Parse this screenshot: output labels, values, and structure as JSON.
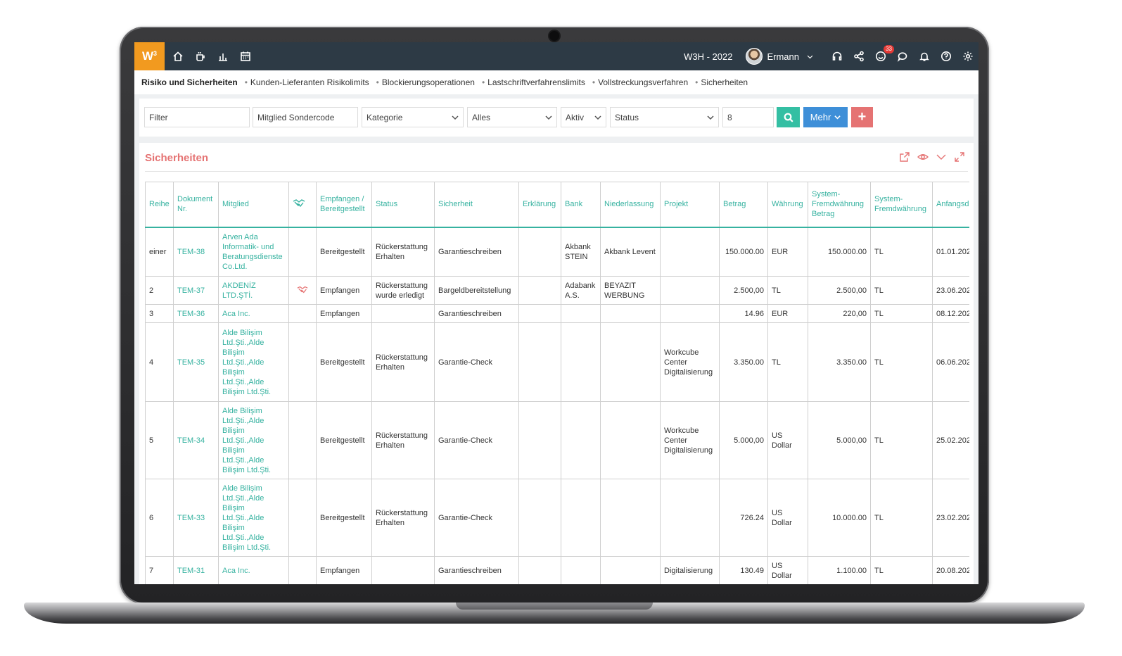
{
  "topbar": {
    "logo": "W",
    "logo_sup": "3",
    "period": "W3H - 2022",
    "user_name": "Ermann",
    "notification_count": "33",
    "nav_icons": [
      "home-icon",
      "coffee-icon",
      "bar-chart-icon",
      "calendar-icon"
    ],
    "right_icons": [
      "headset-icon",
      "share-icon",
      "smiley-icon",
      "chat-icon",
      "bell-icon",
      "help-icon",
      "gear-icon"
    ]
  },
  "breadcrumb": {
    "main": "Risiko und Sicherheiten",
    "items": [
      "Kunden-Lieferanten Risikolimits",
      "Blockierungsoperationen",
      "Lastschriftverfahrenslimits",
      "Vollstreckungsverfahren",
      "Sicherheiten"
    ]
  },
  "filters": {
    "filter": "Filter",
    "member_code": "Mitglied Sondercode",
    "category": "Kategorie",
    "all": "Alles",
    "active": "Aktiv",
    "status": "Status",
    "page_size": "8",
    "more_label": "Mehr",
    "add_label": "+"
  },
  "panel": {
    "title": "Sicherheiten"
  },
  "table": {
    "headers": [
      "Reihe",
      "Dokument Nr.",
      "Mitglied",
      "",
      "Empfangen / Bereitgestellt",
      "Status",
      "Sicherheit",
      "Erklärung",
      "Bank",
      "Niederlassung",
      "Projekt",
      "Betrag",
      "Währung",
      "System-Fremdwährung Betrag",
      "System-Fremdwährung",
      "Anfangsd"
    ],
    "rows": [
      {
        "reihe": "einer",
        "doc": "TEM-38",
        "member": "Arven Ada Informatik- und Beratungsdienste Co.Ltd.",
        "icon": "",
        "type": "Bereitgestellt",
        "status": "Rückerstattung Erhalten",
        "security": "Garantieschreiben",
        "note": "",
        "bank": "Akbank STEIN",
        "branch": "Akbank Levent",
        "project": "",
        "amount": "150.000.00",
        "currency": "EUR",
        "sys_amount": "150.000.00",
        "sys_currency": "TL",
        "start": "01.01.202"
      },
      {
        "reihe": "2",
        "doc": "TEM-37",
        "member": "AKDENİZ LTD.ŞTİ.",
        "icon": "handshake",
        "type": "Empfangen",
        "status": "Rückerstattung wurde erledigt",
        "security": "Bargeldbereitstellung",
        "note": "",
        "bank": "Adabank A.S.",
        "branch": "BEYAZIT WERBUNG",
        "project": "",
        "amount": "2.500,00",
        "currency": "TL",
        "sys_amount": "2.500,00",
        "sys_currency": "TL",
        "start": "23.06.202"
      },
      {
        "reihe": "3",
        "doc": "TEM-36",
        "member": "Aca Inc.",
        "icon": "",
        "type": "Empfangen",
        "status": "",
        "security": "Garantieschreiben",
        "note": "",
        "bank": "",
        "branch": "",
        "project": "",
        "amount": "14.96",
        "currency": "EUR",
        "sys_amount": "220,00",
        "sys_currency": "TL",
        "start": "08.12.202"
      },
      {
        "reihe": "4",
        "doc": "TEM-35",
        "member": "Alde Bilişim Ltd.Şti.,Alde Bilişim Ltd.Şti.,Alde Bilişim Ltd.Şti.,Alde Bilişim Ltd.Şti.",
        "icon": "",
        "type": "Bereitgestellt",
        "status": "Rückerstattung Erhalten",
        "security": "Garantie-Check",
        "note": "",
        "bank": "",
        "branch": "",
        "project": "Workcube Center Digitalisierung",
        "amount": "3.350.00",
        "currency": "TL",
        "sys_amount": "3.350.00",
        "sys_currency": "TL",
        "start": "06.06.202"
      },
      {
        "reihe": "5",
        "doc": "TEM-34",
        "member": "Alde Bilişim Ltd.Şti.,Alde Bilişim Ltd.Şti.,Alde Bilişim Ltd.Şti.,Alde Bilişim Ltd.Şti.",
        "icon": "",
        "type": "Bereitgestellt",
        "status": "Rückerstattung Erhalten",
        "security": "Garantie-Check",
        "note": "",
        "bank": "",
        "branch": "",
        "project": "Workcube Center Digitalisierung",
        "amount": "5.000,00",
        "currency": "US Dollar",
        "sys_amount": "5.000,00",
        "sys_currency": "TL",
        "start": "25.02.202"
      },
      {
        "reihe": "6",
        "doc": "TEM-33",
        "member": "Alde Bilişim Ltd.Şti.,Alde Bilişim Ltd.Şti.,Alde Bilişim Ltd.Şti.,Alde Bilişim Ltd.Şti.",
        "icon": "",
        "type": "Bereitgestellt",
        "status": "Rückerstattung Erhalten",
        "security": "Garantie-Check",
        "note": "",
        "bank": "",
        "branch": "",
        "project": "",
        "amount": "726.24",
        "currency": "US Dollar",
        "sys_amount": "10.000.00",
        "sys_currency": "TL",
        "start": "23.02.202"
      },
      {
        "reihe": "7",
        "doc": "TEM-31",
        "member": "Aca Inc.",
        "icon": "",
        "type": "Empfangen",
        "status": "",
        "security": "Garantieschreiben",
        "note": "",
        "bank": "",
        "branch": "",
        "project": "Digitalisierung",
        "amount": "130.49",
        "currency": "US Dollar",
        "sys_amount": "1.100.00",
        "sys_currency": "TL",
        "start": "20.08.202"
      }
    ]
  },
  "colors": {
    "topbar": "#2d3a45",
    "logo": "#f29a1f",
    "accent_teal": "#36b2a0",
    "accent_red": "#e57373",
    "button_blue": "#3e8fd8"
  }
}
